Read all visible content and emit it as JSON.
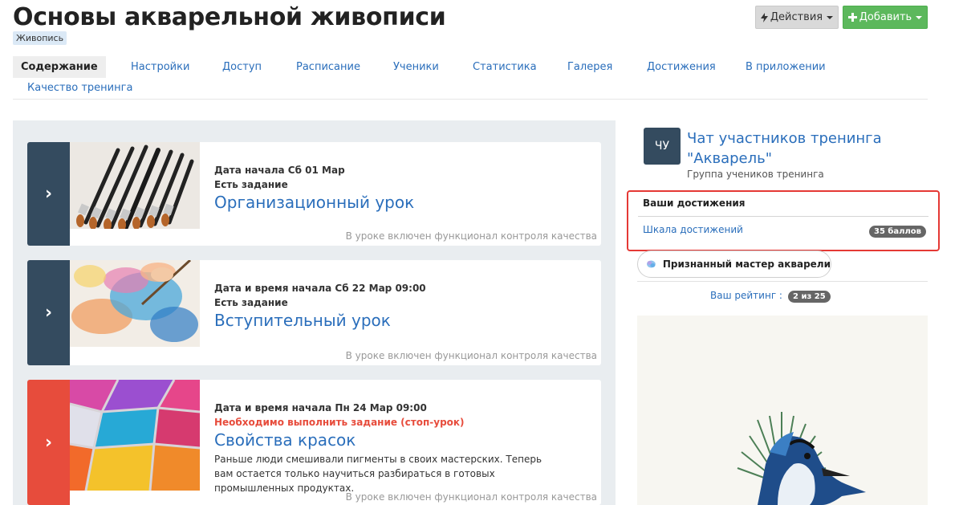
{
  "header": {
    "title": "Основы акварельной живописи",
    "category": "Живопись",
    "actions_label": "Действия",
    "add_label": "Добавить",
    "colors": {
      "actions_bg": "#d9d9d9",
      "add_bg": "#5cb85c"
    }
  },
  "tabs": [
    {
      "label": "Содержание"
    },
    {
      "label": "Настройки"
    },
    {
      "label": "Доступ"
    },
    {
      "label": "Расписание"
    },
    {
      "label": "Ученики"
    },
    {
      "label": "Статистика"
    },
    {
      "label": "Галерея"
    },
    {
      "label": "Достижения"
    },
    {
      "label": "В приложении"
    },
    {
      "label": "Качество тренинга"
    }
  ],
  "lessons": [
    {
      "date": "Дата начала Сб 01 Мар",
      "task": "Есть задание",
      "title": "Организационный урок",
      "description": "",
      "quality_note": "В уроке включен функционал контроля качества",
      "image": "brushes-photo"
    },
    {
      "date": "Дата и время начала Сб 22 Мар 09:00",
      "task": "Есть задание",
      "title": "Вступительный урок",
      "description": "",
      "quality_note": "В уроке включен функционал контроля качества",
      "image": "watercolor-painting-photo"
    },
    {
      "date": "Дата и время начала Пн 24 Мар 09:00",
      "task": "Необходимо выполнить задание (стоп-урок)",
      "title": "Свойства красок",
      "description": "Раньше люди смешивали пигменты в своих мастерских. Теперь вам остается только научиться разбираться в готовых промышленных продуктах.",
      "quality_note": "В уроке включен функционал контроля качества",
      "image": "pigments-photo"
    }
  ],
  "sidebar": {
    "chat": {
      "avatar_initials": "ЧУ",
      "title": "Чат участников тренинга \"Акварель\"",
      "subtitle": "Группа учеников тренинга"
    },
    "achievements": {
      "header": "Ваши достижения",
      "scale_link": "Шкала достижений",
      "points_badge": "35 баллов"
    },
    "badge": {
      "label": "Признанный мастер акварели",
      "icon": "watercolor-blot-icon"
    },
    "rating": {
      "label": "Ваш рейтинг :",
      "value": "2 из 25"
    },
    "illustration": "watercolor-blue-jay-bird"
  },
  "colors": {
    "link": "#2a6ebb",
    "lesson_arrow": "#344b5f",
    "lesson_arrow_stop": "#e74c3c",
    "stop_task_text": "#e74c3c",
    "highlight_border": "#e53935",
    "panel_bg": "#e9edf0"
  }
}
